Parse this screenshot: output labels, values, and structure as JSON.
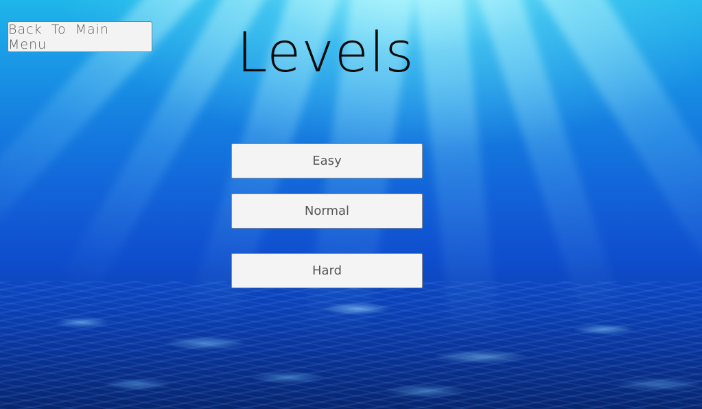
{
  "screen": {
    "title": "Levels"
  },
  "navigation": {
    "back_label": "Back To Main Menu"
  },
  "levels": [
    {
      "label": "Easy"
    },
    {
      "label": "Normal"
    },
    {
      "label": "Hard"
    }
  ],
  "colors": {
    "water_top": "#1fb6ea",
    "water_bottom": "#08256e",
    "button_bg": "#f4f4f4",
    "button_text": "#555555",
    "title_text": "#0a0a0a"
  }
}
